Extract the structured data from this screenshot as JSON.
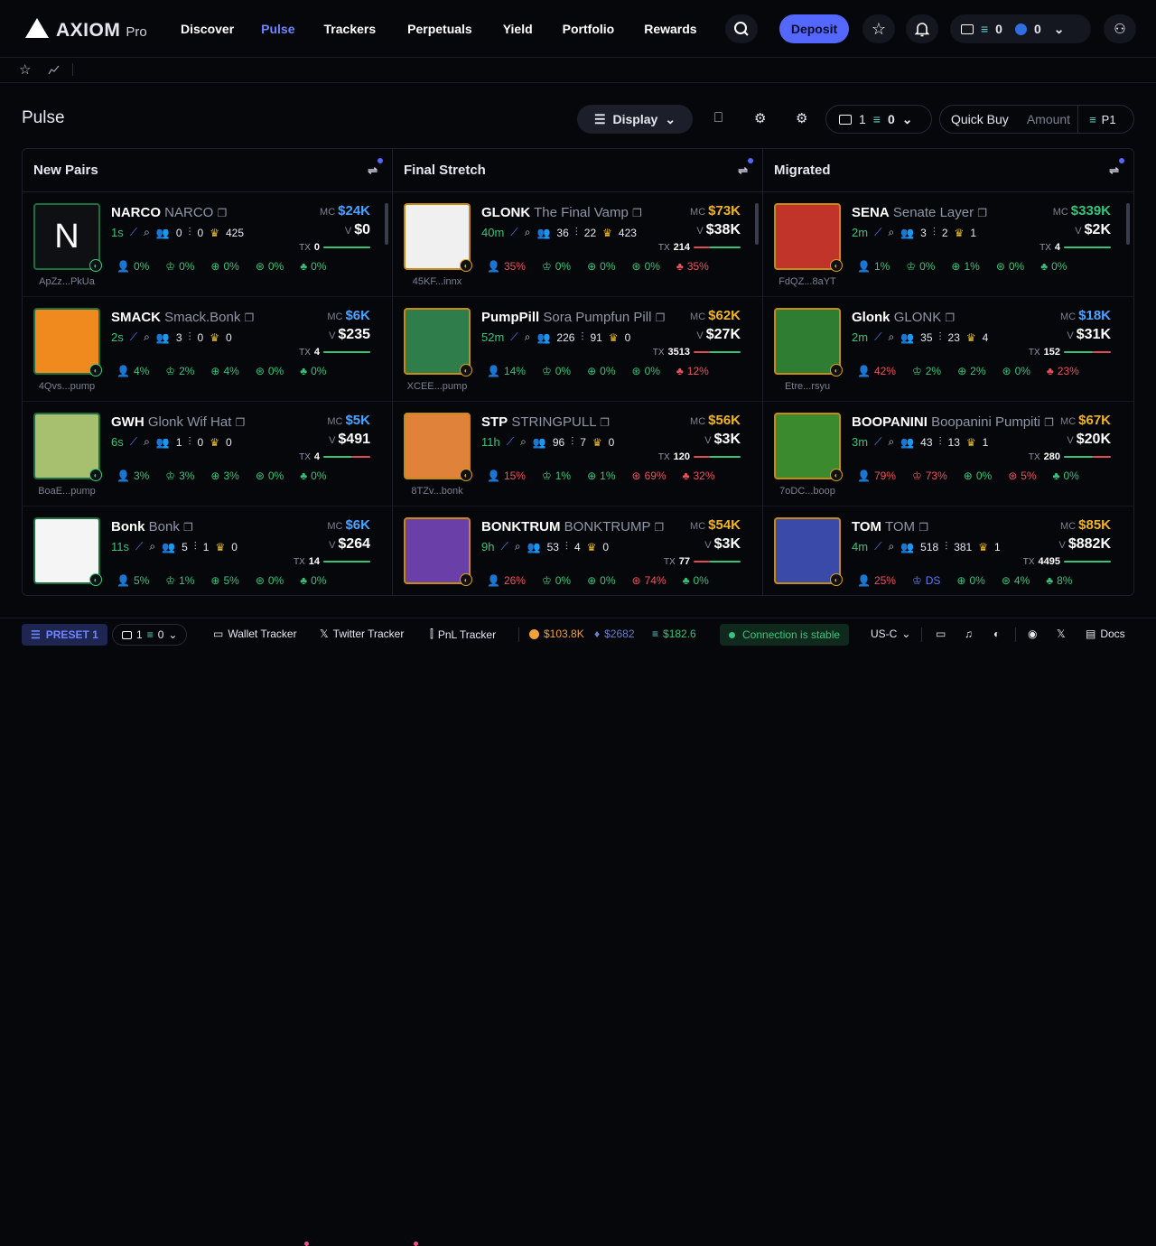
{
  "app": {
    "brand": "AXIOM",
    "brand_suffix": "Pro"
  },
  "nav": [
    {
      "label": "Discover",
      "active": false
    },
    {
      "label": "Pulse",
      "active": true
    },
    {
      "label": "Trackers",
      "active": false
    },
    {
      "label": "Perpetuals",
      "active": false
    },
    {
      "label": "Yield",
      "active": false
    },
    {
      "label": "Portfolio",
      "active": false
    },
    {
      "label": "Rewards",
      "active": false
    }
  ],
  "header": {
    "deposit_label": "Deposit",
    "wallet_sol": "0",
    "wallet_usdc": "0"
  },
  "page": {
    "title": "Pulse",
    "display_label": "Display",
    "wallet_count": "1",
    "sol_amount": "0",
    "quick_buy_label": "Quick Buy",
    "amount_placeholder": "Amount",
    "preset": "P1"
  },
  "columns": [
    {
      "title": "New Pairs",
      "cards": [
        {
          "symbol": "NARCO",
          "name": "NARCO",
          "thumb_text": "N",
          "addr": "ApZz...PkUa",
          "age": "1s",
          "holders": "0",
          "pro": "0",
          "crown": "425",
          "mc": "$24K",
          "mc_color": "#4aa3ff",
          "vol": "$0",
          "tx": "0",
          "stats": [
            "0%",
            "0%",
            "0%",
            "0%",
            "0%"
          ]
        },
        {
          "symbol": "SMACK",
          "name": "Smack.Bonk",
          "thumb_text": "",
          "addr": "4Qvs...pump",
          "age": "2s",
          "holders": "3",
          "pro": "0",
          "crown": "0",
          "mc": "$6K",
          "mc_color": "#4aa3ff",
          "vol": "$235",
          "tx": "4",
          "stats": [
            "4%",
            "2%",
            "4%",
            "0%",
            "0%"
          ]
        },
        {
          "symbol": "GWH",
          "name": "Glonk Wif Hat",
          "thumb_text": "",
          "addr": "BoaE...pump",
          "age": "6s",
          "holders": "1",
          "pro": "0",
          "crown": "0",
          "mc": "$5K",
          "mc_color": "#4aa3ff",
          "vol": "$491",
          "tx": "4",
          "stats": [
            "3%",
            "3%",
            "3%",
            "0%",
            "0%"
          ]
        },
        {
          "symbol": "Bonk",
          "name": "Bonk",
          "thumb_text": "",
          "addr": "",
          "age": "11s",
          "holders": "5",
          "pro": "1",
          "crown": "0",
          "mc": "$6K",
          "mc_color": "#4aa3ff",
          "vol": "$264",
          "tx": "14",
          "stats": [
            "5%",
            "1%",
            "5%",
            "0%",
            "0%"
          ]
        }
      ]
    },
    {
      "title": "Final Stretch",
      "cards": [
        {
          "symbol": "GLONK",
          "name": "The Final Vamp",
          "thumb_text": "",
          "addr": "45KF...innx",
          "age": "40m",
          "holders": "36",
          "pro": "22",
          "crown": "423",
          "mc": "$73K",
          "mc_color": "#f0b429",
          "vol": "$38K",
          "tx": "214",
          "stats": [
            "35%",
            "0%",
            "0%",
            "0%",
            "35%"
          ]
        },
        {
          "symbol": "PumpPill",
          "name": "Sora Pumpfun Pill",
          "thumb_text": "",
          "addr": "XCEE...pump",
          "age": "52m",
          "holders": "226",
          "pro": "91",
          "crown": "0",
          "mc": "$62K",
          "mc_color": "#f0b429",
          "vol": "$27K",
          "tx": "3513",
          "stats": [
            "14%",
            "0%",
            "0%",
            "0%",
            "12%"
          ]
        },
        {
          "symbol": "STP",
          "name": "STRINGPULL",
          "thumb_text": "",
          "addr": "8TZv...bonk",
          "age": "11h",
          "holders": "96",
          "pro": "7",
          "crown": "0",
          "mc": "$56K",
          "mc_color": "#f0b429",
          "vol": "$3K",
          "tx": "120",
          "stats": [
            "15%",
            "1%",
            "1%",
            "69%",
            "32%"
          ]
        },
        {
          "symbol": "BONKTRUM",
          "name": "BONKTRUMP",
          "thumb_text": "",
          "addr": "",
          "age": "9h",
          "holders": "53",
          "pro": "4",
          "crown": "0",
          "mc": "$54K",
          "mc_color": "#f0b429",
          "vol": "$3K",
          "tx": "77",
          "stats": [
            "26%",
            "0%",
            "0%",
            "74%",
            "0%"
          ]
        }
      ]
    },
    {
      "title": "Migrated",
      "cards": [
        {
          "symbol": "SENA",
          "name": "Senate Layer",
          "thumb_text": "",
          "addr": "FdQZ...8aYT",
          "age": "2m",
          "holders": "3",
          "pro": "2",
          "crown": "1",
          "mc": "$339K",
          "mc_color": "#36c47c",
          "vol": "$2K",
          "tx": "4",
          "stats": [
            "1%",
            "0%",
            "1%",
            "0%",
            "0%"
          ]
        },
        {
          "symbol": "Glonk",
          "name": "GLONK",
          "thumb_text": "",
          "addr": "Etre...rsyu",
          "age": "2m",
          "holders": "35",
          "pro": "23",
          "crown": "4",
          "mc": "$18K",
          "mc_color": "#4aa3ff",
          "vol": "$31K",
          "tx": "152",
          "stats": [
            "42%",
            "2%",
            "2%",
            "0%",
            "23%"
          ]
        },
        {
          "symbol": "BOOPANINI",
          "name": "Boopanini Pumpiti",
          "thumb_text": "",
          "addr": "7oDC...boop",
          "age": "3m",
          "holders": "43",
          "pro": "13",
          "crown": "1",
          "mc": "$67K",
          "mc_color": "#f0b429",
          "vol": "$20K",
          "tx": "280",
          "stats": [
            "79%",
            "73%",
            "0%",
            "5%",
            "0%"
          ]
        },
        {
          "symbol": "TOM",
          "name": "TOM",
          "thumb_text": "",
          "addr": "",
          "age": "4m",
          "holders": "518",
          "pro": "381",
          "crown": "1",
          "mc": "$85K",
          "mc_color": "#f0b429",
          "vol": "$882K",
          "tx": "4495",
          "stats": [
            "25%",
            "DS",
            "0%",
            "4%",
            "8%"
          ]
        }
      ]
    }
  ],
  "footer": {
    "preset_label": "PRESET 1",
    "wallet_count": "1",
    "sol": "0",
    "wallet_tracker": "Wallet Tracker",
    "twitter_tracker": "Twitter Tracker",
    "pnl_tracker": "PnL Tracker",
    "btc": "$103.8K",
    "eth": "$2682",
    "sol_price": "$182.6",
    "connection": "Connection is stable",
    "region": "US-C",
    "docs": "Docs"
  },
  "colors": {
    "accent": "#5468ff",
    "green": "#36c47c",
    "red": "#f0505e",
    "gold": "#f0b429"
  }
}
